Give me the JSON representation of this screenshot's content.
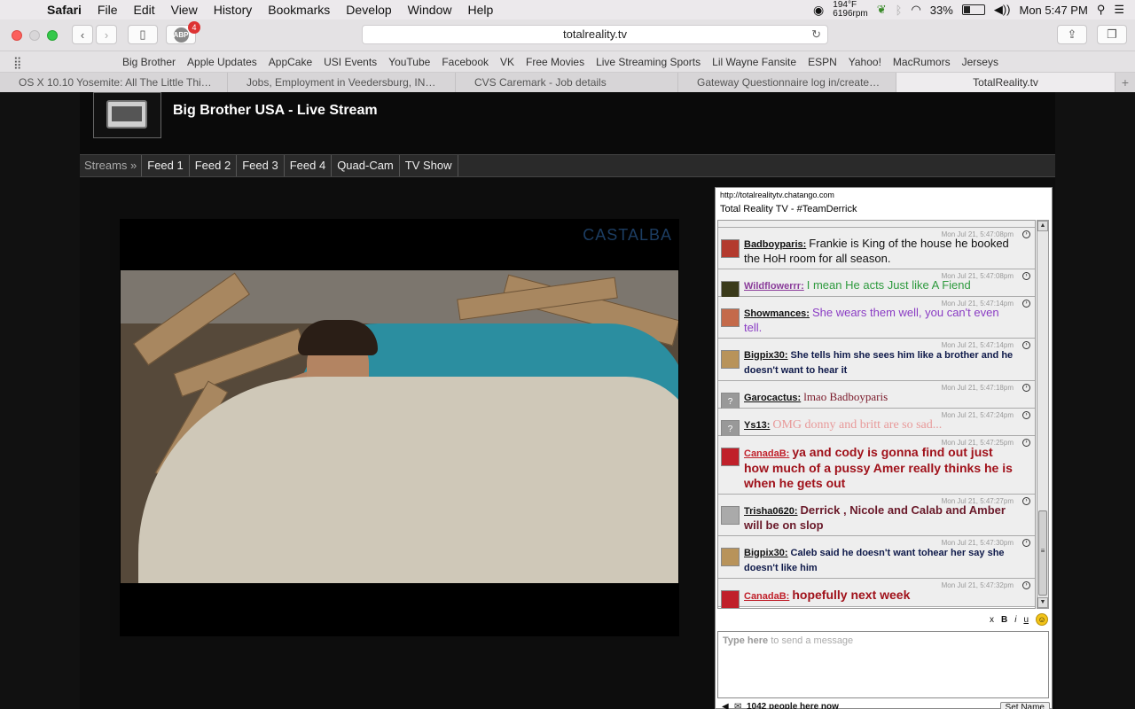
{
  "menubar": {
    "apple_icon": "apple-icon",
    "app": "Safari",
    "items": [
      "File",
      "Edit",
      "View",
      "History",
      "Bookmarks",
      "Develop",
      "Window",
      "Help"
    ],
    "temp": "194°F",
    "rpm": "6196rpm",
    "battery_percent": "33%",
    "battery_level": 0.33,
    "clock": "Mon 5:47 PM"
  },
  "toolbar": {
    "url": "totalreality.tv",
    "abp_label": "ABP",
    "abp_badge": "4"
  },
  "bookmarks": [
    "Big Brother",
    "Apple Updates",
    "AppCake",
    "USI Events",
    "YouTube",
    "Facebook",
    "VK",
    "Free Movies",
    "Live Streaming Sports",
    "Lil Wayne Fansite",
    "ESPN",
    "Yahoo!",
    "MacRumors",
    "Jerseys"
  ],
  "tabs": [
    {
      "label": "OS X 10.10 Yosemite: All The Little Thi…",
      "active": false
    },
    {
      "label": "Jobs, Employment in Veedersburg, IN…",
      "active": false
    },
    {
      "label": "CVS Caremark - Job details",
      "active": false
    },
    {
      "label": "Gateway Questionnaire log in/create…",
      "active": false
    },
    {
      "label": "TotalReality.tv",
      "active": true
    }
  ],
  "site": {
    "title": "Big Brother USA - Live Stream",
    "nav_lead": "Streams »",
    "nav": [
      "Feed 1",
      "Feed 2",
      "Feed 3",
      "Feed 4",
      "Quad-Cam",
      "TV Show"
    ],
    "watermark": "CASTALBA"
  },
  "chat": {
    "url": "http://totalrealitytv.chatango.com",
    "title": "Total Reality TV - #TeamDerrick",
    "messages": [
      {
        "user": "Badboyparis:",
        "text": "Frankie is King of the house he booked the HoH room for all season.",
        "ts": "Mon Jul 21, 5:47:08pm",
        "color": "#111111",
        "ucolor": "#111111",
        "avatar": "#b33a2e"
      },
      {
        "user": "Wildflowerrr:",
        "text": "I mean He acts Just like A Fiend",
        "ts": "Mon Jul 21, 5:47:08pm",
        "color": "#2e9a3e",
        "ucolor": "#8a3c9a",
        "avatar": "#3a3a1a"
      },
      {
        "user": "Showmances:",
        "text": "She wears them well, you can't even tell.",
        "ts": "Mon Jul 21, 5:47:14pm",
        "color": "#8a3cc4",
        "ucolor": "#111111",
        "avatar": "#c46a4a"
      },
      {
        "user": "Bigpix30:",
        "text": "She tells him she sees him like a brother and he doesn't want to hear it",
        "ts": "Mon Jul 21, 5:47:14pm",
        "color": "#0f1a4a",
        "ucolor": "#111111",
        "avatar": "#b8935a"
      },
      {
        "user": "Garocactus:",
        "text": "lmao Badboyparis",
        "ts": "Mon Jul 21, 5:47:18pm",
        "color": "#7a1a2a",
        "ucolor": "#111111",
        "avatar": "#999999"
      },
      {
        "user": "Ys13:",
        "text": "OMG donny and britt are so sad...",
        "ts": "Mon Jul 21, 5:47:24pm",
        "color": "#e89a9a",
        "ucolor": "#111111",
        "avatar": "#999999"
      },
      {
        "user": "CanadaB:",
        "text": "ya and cody is gonna find out just how much of a pussy Amer really thinks he is when he gets out",
        "ts": "Mon Jul 21, 5:47:25pm",
        "color": "#a0111a",
        "ucolor": "#c0202a",
        "avatar": "#c0202a"
      },
      {
        "user": "Trisha0620:",
        "text": "Derrick , Nicole and Calab and Amber will be on slop",
        "ts": "Mon Jul 21, 5:47:27pm",
        "color": "#6a1a2a",
        "ucolor": "#111111",
        "avatar": "#aaaaaa"
      },
      {
        "user": "Bigpix30:",
        "text": "Caleb said he doesn't want tohear her say she doesn't like him",
        "ts": "Mon Jul 21, 5:47:30pm",
        "color": "#0f1a4a",
        "ucolor": "#111111",
        "avatar": "#b8935a"
      },
      {
        "user": "CanadaB:",
        "text": "hopefully next week",
        "ts": "Mon Jul 21, 5:47:32pm",
        "color": "#a0111a",
        "ucolor": "#c0202a",
        "avatar": "#c0202a"
      }
    ],
    "format_buttons": [
      "x",
      "B",
      "i",
      "u"
    ],
    "input_placeholder_strong": "Type here",
    "input_placeholder_rest": "to send a message",
    "people_count": "1042 people here now",
    "set_name": "Set Name"
  }
}
